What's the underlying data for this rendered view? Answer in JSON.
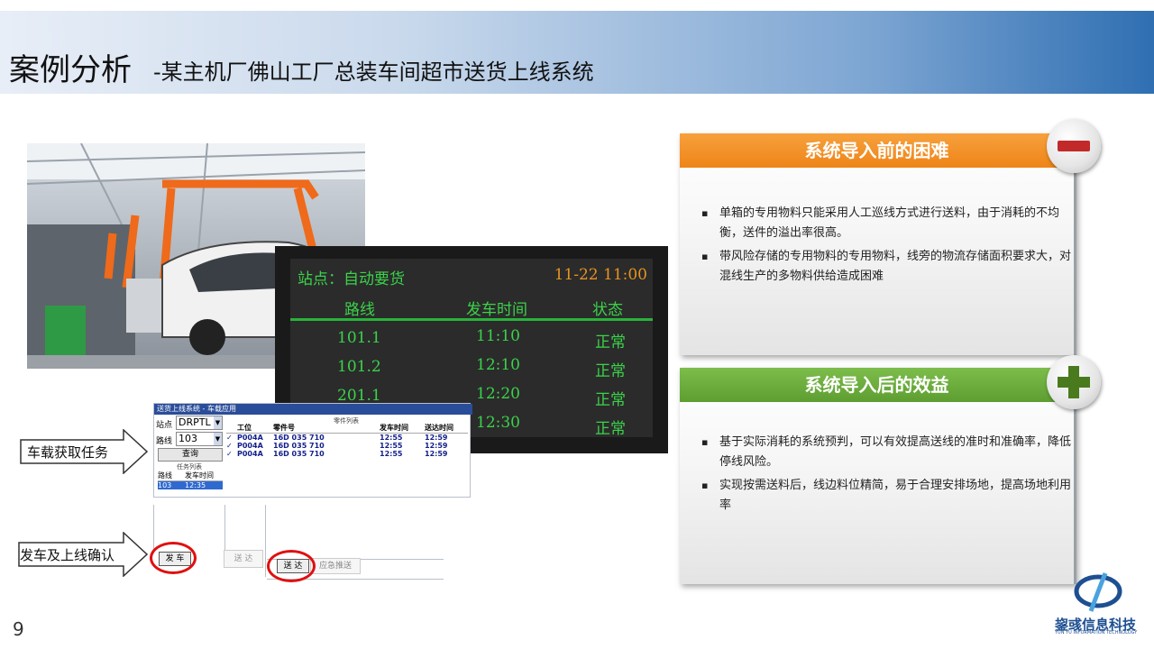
{
  "header": {
    "title_main": "案例分析",
    "title_sub": "-某主机厂佛山工厂总装车间超市送货上线系统"
  },
  "board": {
    "station": "站点：自动要货",
    "datetime": "11-22 11:00",
    "columns": [
      "路线",
      "发车时间",
      "状态"
    ],
    "rows": [
      {
        "route": "101.1",
        "time": "11:10",
        "status": "正常"
      },
      {
        "route": "101.2",
        "time": "12:10",
        "status": "正常"
      },
      {
        "route": "201.1",
        "time": "12:20",
        "status": "正常"
      },
      {
        "route": "",
        "time": "12:30",
        "status": "正常"
      }
    ]
  },
  "flow": {
    "step1": "车载获取任务",
    "step2": "发车及上线确认"
  },
  "app": {
    "window_title": "送货上线系统 - 车载应用",
    "station_label": "站点",
    "station_value": "DRPTL",
    "route_label": "路线",
    "route_value": "103",
    "query_button": "查询",
    "task_list_title": "任务列表",
    "task_columns": [
      "路线",
      "发车时间"
    ],
    "task_rows": [
      [
        "103",
        "12:35"
      ]
    ],
    "parts_list_title": "零件列表",
    "parts_columns": [
      "工位",
      "零件号",
      "发车时间",
      "送达时间"
    ],
    "parts_rows": [
      [
        "P004A",
        "16D 035 710",
        "12:55",
        "12:59"
      ],
      [
        "P004A",
        "16D 035 710",
        "12:55",
        "12:59"
      ],
      [
        "P004A",
        "16D 035 710",
        "12:55",
        "12:59"
      ]
    ],
    "depart_button": "发 车",
    "deliver_button_gray": "送 达",
    "deliver_button": "送 达",
    "urgent_button": "应急推送"
  },
  "panel_before": {
    "title": "系统导入前的困难",
    "bullets": [
      "单箱的专用物料只能采用人工巡线方式进行送料，由于消耗的不均衡，送件的溢出率很高。",
      "带风险存储的专用物料的专用物料，线旁的物流存储面积要求大，对混线生产的多物料供给造成困难"
    ]
  },
  "panel_after": {
    "title": "系统导入后的效益",
    "bullets": [
      "基于实际消耗的系统预判，可以有效提高送线的准时和准确率，降低停线风险。",
      "实现按需送料后，线边料位精简，易于合理安排场地，提高场地利用率"
    ]
  },
  "footer": {
    "page_number": "9",
    "logo_name": "鋆彧信息科技",
    "logo_sub": "YUN YU INFORMATION TECHNOLOGY"
  },
  "colors": {
    "before_header": "#f28b1e",
    "after_header": "#6aad3c",
    "board_text": "#3bd24a",
    "board_time": "#e8931e",
    "minus_icon": "#c22a2a",
    "plus_icon": "#4a7a1e"
  },
  "icons": [
    "minus-icon",
    "plus-icon",
    "arrow-right-icon",
    "logo-icon",
    "dropdown-icon",
    "checkbox-icon"
  ]
}
